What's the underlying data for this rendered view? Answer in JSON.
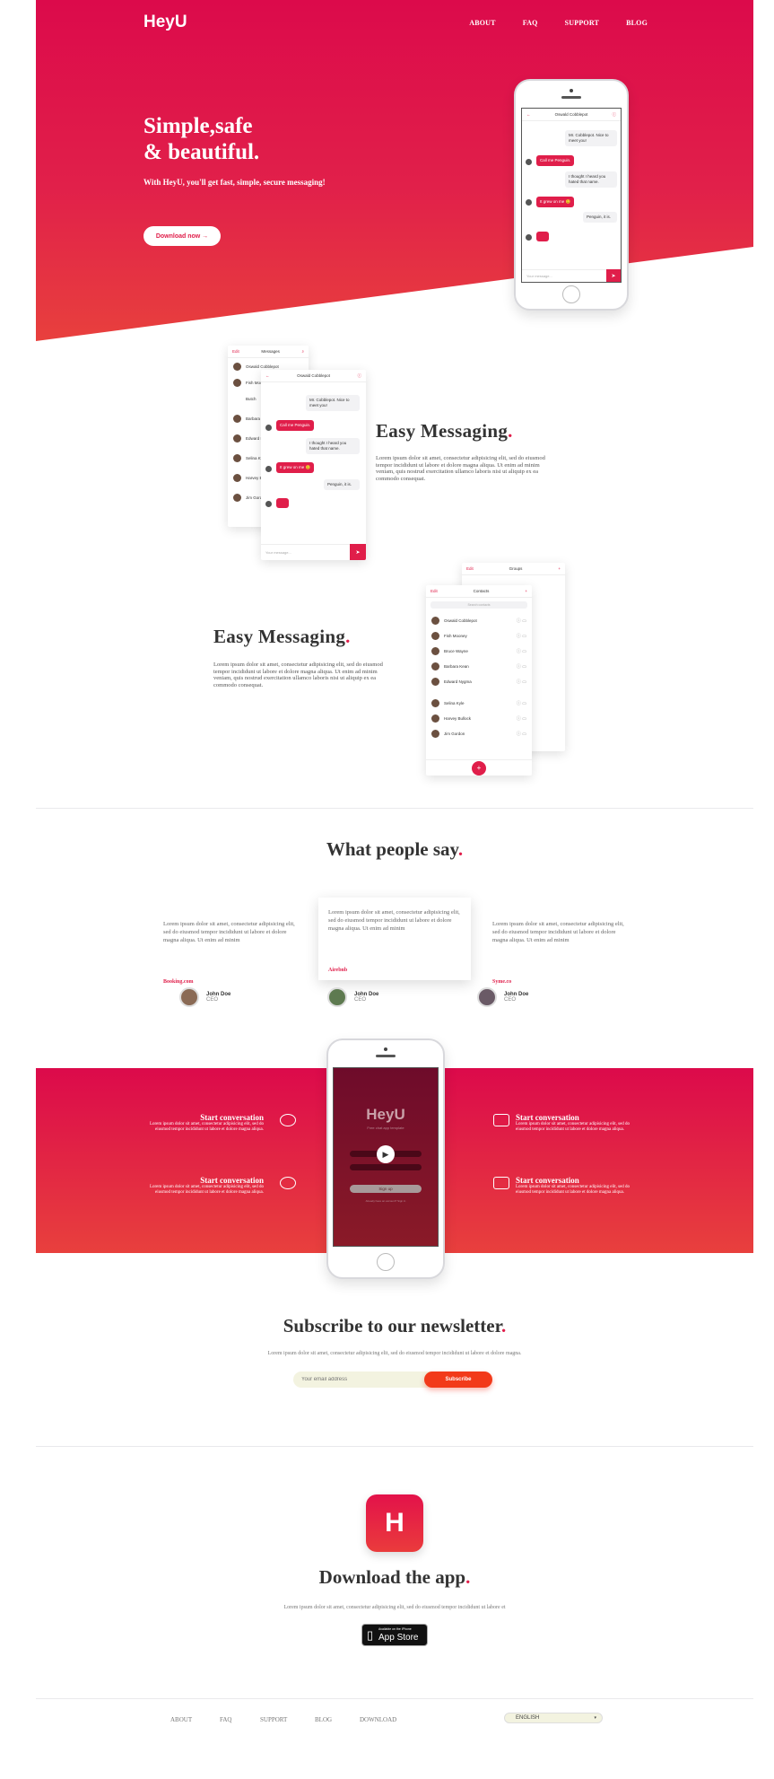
{
  "header": {
    "logo": "HeyU",
    "nav": [
      "ABOUT",
      "FAQ",
      "SUPPORT",
      "BLOG"
    ]
  },
  "hero": {
    "title_line1": "Simple,safe",
    "title_line2": "& beautiful.",
    "subtitle": "With HeyU, you'll get fast, simple, secure messaging!",
    "cta": "Download now"
  },
  "chat": {
    "contact": "Oswald Cobblepot",
    "messages": [
      {
        "dir": "in",
        "text": "Mr. Cobblepot. Nice to meet you!"
      },
      {
        "dir": "out",
        "text": "Call me Penguin."
      },
      {
        "dir": "in",
        "text": "I thought I heard you hated that name."
      },
      {
        "dir": "out",
        "text": "It grew on me 😊"
      },
      {
        "dir": "in",
        "text": "Penguin, it is."
      }
    ],
    "input_placeholder": "Your message...",
    "send_icon": "send-icon"
  },
  "messages_list": {
    "edit": "Edit",
    "title": "Messages",
    "items": [
      "Oswald Cobblepot",
      "Fish Mooney",
      "Butch",
      "Barbara Kean",
      "Edward Nygma",
      "Selina Kyle",
      "Harvey Bullock",
      "Jim Gordon"
    ]
  },
  "feature1": {
    "title": "Easy Messaging",
    "text": "Lorem ipsum dolor sit amet, consectetur adipisicing elit, sed do eiusmod tempor incididunt ut labore et dolore magna aliqua. Ut enim ad minim veniam, quis nostrud exercitation ullamco laboris nisi ut aliquip ex ea commodo consequat."
  },
  "feature2": {
    "title": "Easy Messaging",
    "text": "Lorem ipsum dolor sit amet, consectetur adipisicing elit, sed do eiusmod tempor incididunt ut labore et dolore magna aliqua. Ut enim ad minim veniam, quis nostrud exercitation ullamco laboris nisi ut aliquip ex ea commodo consequat."
  },
  "contacts": {
    "edit": "Edit",
    "title": "Contacts",
    "groups_title": "Groups",
    "search_placeholder": "Search contacts",
    "items": [
      "Oswald Cobblepot",
      "Fish Mooney",
      "Bruce Wayne",
      "Barbara Kean",
      "Edward Nygma",
      "Selina Kyle",
      "Harvey Bullock",
      "Jim Gordon"
    ]
  },
  "testimonials": {
    "title": "What people say",
    "items": [
      {
        "text": "Lorem ipsum dolor sit amet, consectetur adipisicing elit, sed do eiusmod tempor incididunt ut labore et dolore magna aliqua. Ut enim ad minim",
        "company": "Booking.com",
        "name": "John Doe",
        "role": "CEO"
      },
      {
        "text": "Lorem ipsum dolor sit amet, consectetur adipisicing elit, sed do eiusmod tempor incididunt ut labore et dolore magna aliqua. Ut enim ad minim",
        "company": "Airebnb",
        "name": "John Doe",
        "role": "CEO"
      },
      {
        "text": "Lorem ipsum dolor sit amet, consectetur adipisicing elit, sed do eiusmod tempor incididunt ut labore et dolore magna aliqua. Ut enim ad minim",
        "company": "Syme.co",
        "name": "John Doe",
        "role": "CEO"
      }
    ]
  },
  "features_band": {
    "items": [
      {
        "title": "Start conversation",
        "text": "Lorem ipsum dolor sit amet, consectetur adipisicing elit, sed do eiusmod tempor incididunt ut labore et dolore magna aliqua."
      },
      {
        "title": "Start conversation",
        "text": "Lorem ipsum dolor sit amet, consectetur adipisicing elit, sed do eiusmod tempor incididunt ut labore et dolore magna aliqua."
      },
      {
        "title": "Start conversation",
        "text": "Lorem ipsum dolor sit amet, consectetur adipisicing elit, sed do eiusmod tempor incididunt ut labore et dolore magna aliqua."
      },
      {
        "title": "Start conversation",
        "text": "Lorem ipsum dolor sit amet, consectetur adipisicing elit, sed do eiusmod tempor incididunt ut labore et dolore magna aliqua."
      }
    ],
    "phone_logo": "HeyU",
    "phone_tagline": "Free chat app template",
    "phone_signup": "Sign up",
    "phone_footer": "Already have an account? Sign in"
  },
  "newsletter": {
    "title": "Subscribe to our newsletter",
    "text": "Lorem ipsum dolor sit amet, consectetur adipisicing elit, sed do eiusmod tempor incididunt ut labore et dolore magna.",
    "placeholder": "Your email address",
    "button": "Subscribe"
  },
  "download": {
    "icon_letter": "H",
    "title": "Download the app",
    "text": "Lorem ipsum dolor sit amet, consectetur adipisicing elit, sed do eiusmod tempor incididunt ut labore et",
    "badge_small": "Available on the iPhone",
    "badge_big": "App Store"
  },
  "footer": {
    "nav": [
      "ABOUT",
      "FAQ",
      "SUPPORT",
      "BLOG",
      "DOWNLOAD"
    ],
    "language": "ENGLISH"
  },
  "colors": {
    "accent": "#e01e4a",
    "accent_orange": "#e8403d"
  }
}
